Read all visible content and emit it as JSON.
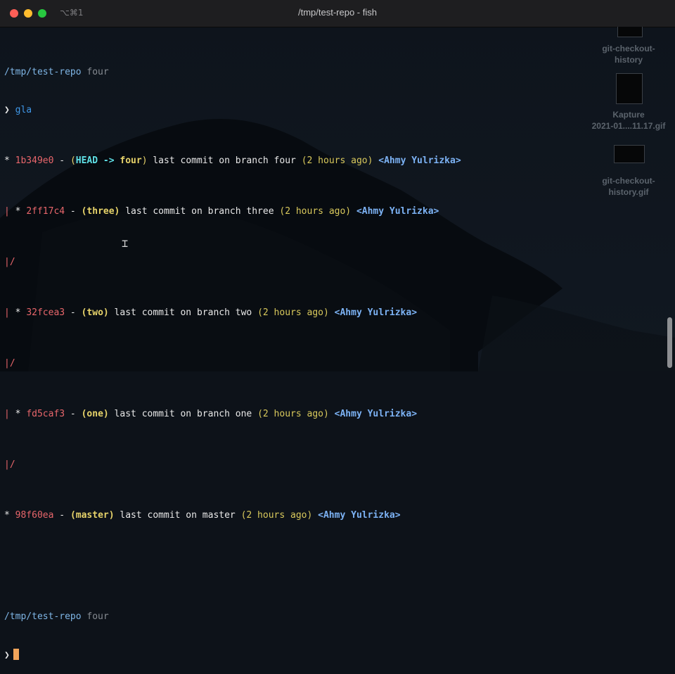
{
  "window": {
    "title": "/tmp/test-repo - fish",
    "shortcut": "⌥⌘1"
  },
  "desktop": {
    "icons": [
      {
        "label_line1": "git-checkout-",
        "label_line2": "history"
      },
      {
        "label_line1": "Kapture",
        "label_line2": "2021-01....11.17.gif"
      },
      {
        "label_line1": "git-checkout-",
        "label_line2": "history.gif"
      }
    ]
  },
  "terminal": {
    "prompt1": {
      "path": "/tmp/test-repo",
      "branch": "four"
    },
    "prompt_symbol": "❯",
    "command": "gla",
    "log": [
      {
        "graph": "* ",
        "hash": "1b349e0",
        "sep": " - ",
        "refs": "(HEAD -> four)",
        "message": " last commit on branch four ",
        "time": "(2 hours ago)",
        "author": "<Ahmy Yulrizka>"
      },
      {
        "graph": "| * ",
        "hash": "2ff17c4",
        "sep": " - ",
        "refs": "(three)",
        "message": " last commit on branch three ",
        "time": "(2 hours ago)",
        "author": "<Ahmy Yulrizka>"
      },
      {
        "graph": "|/"
      },
      {
        "graph": "| * ",
        "hash": "32fcea3",
        "sep": " - ",
        "refs": "(two)",
        "message": " last commit on branch two ",
        "time": "(2 hours ago)",
        "author": "<Ahmy Yulrizka>"
      },
      {
        "graph": "|/"
      },
      {
        "graph": "| * ",
        "hash": "fd5caf3",
        "sep": " - ",
        "refs": "(one)",
        "message": " last commit on branch one ",
        "time": "(2 hours ago)",
        "author": "<Ahmy Yulrizka>"
      },
      {
        "graph": "|/"
      },
      {
        "graph": "* ",
        "hash": "98f60ea",
        "sep": " - ",
        "refs": "(master)",
        "message": " last commit on master ",
        "time": "(2 hours ago)",
        "author": "<Ahmy Yulrizka>"
      }
    ],
    "prompt2": {
      "path": "/tmp/test-repo",
      "branch": "four"
    }
  },
  "colors": {
    "hash": "#e8666b",
    "head": "#5fe0e6",
    "ref": "#e7d36a",
    "author": "#7cb2f4",
    "cursor": "#f1a45a"
  }
}
